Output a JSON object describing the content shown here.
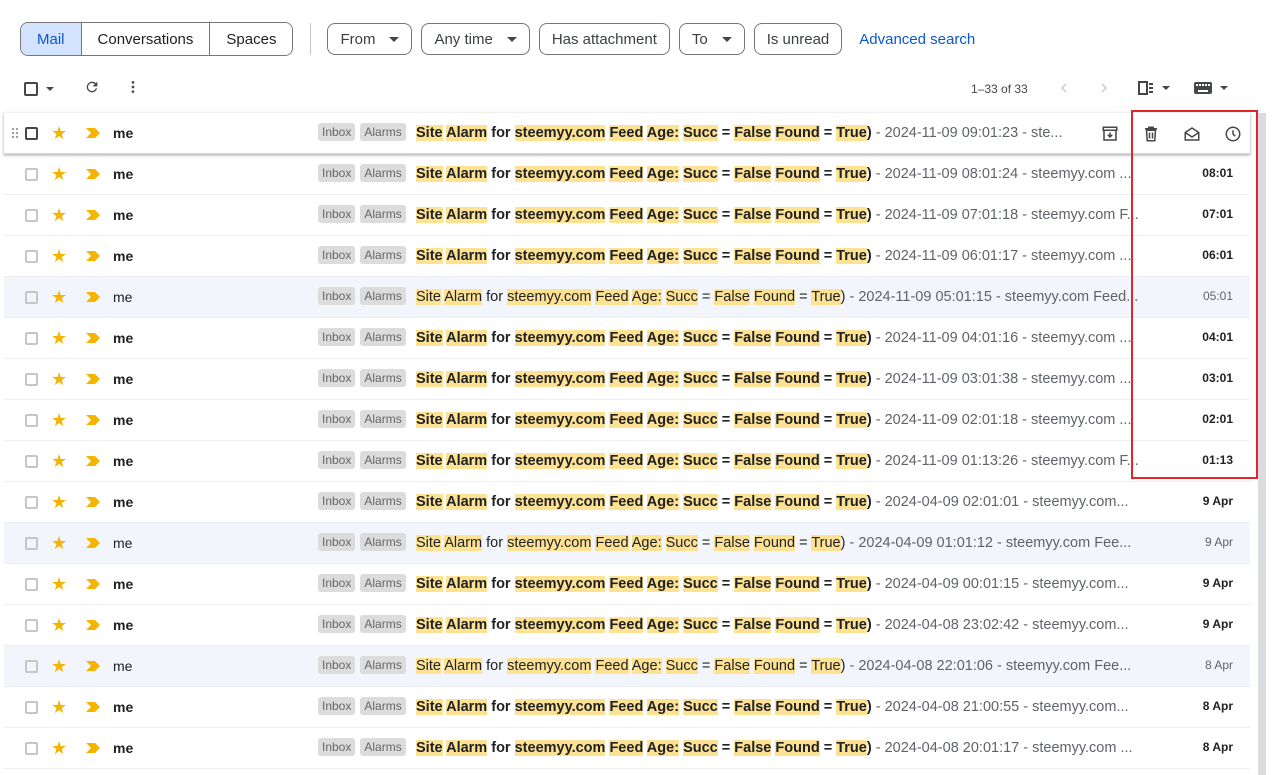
{
  "tabs": [
    {
      "label": "Mail",
      "active": true
    },
    {
      "label": "Conversations",
      "active": false
    },
    {
      "label": "Spaces",
      "active": false
    }
  ],
  "filters": {
    "from": "From",
    "any_time": "Any time",
    "has_attachment": "Has attachment",
    "to": "To",
    "is_unread": "Is unread",
    "advanced_search": "Advanced search"
  },
  "toolbar": {
    "pager": "1–33 of 33",
    "icons": [
      "select-all-checkbox",
      "refresh-icon",
      "more-vert-icon",
      "prev-page-icon",
      "next-page-icon",
      "split-pane-icon",
      "keyboard-icon"
    ]
  },
  "hover_actions": [
    "archive-icon",
    "delete-icon",
    "mark-read-icon",
    "snooze-icon"
  ],
  "colors": {
    "accent": "#0b57d0",
    "chip_active_bg": "#d3e3fd",
    "highlight": "#fde293",
    "star": "#f4b400",
    "annotation_box": "#e3242b"
  },
  "emails": [
    {
      "sender": "me",
      "labels": [
        "Inbox",
        "Alarms"
      ],
      "subject_parts": [
        "Site",
        "Alarm",
        "for",
        "steemyy.com",
        "Feed",
        "Age:",
        "Succ",
        "=",
        "False",
        "Found",
        "=",
        "True)"
      ],
      "snippet": "- 2024-11-09 09:01:23 - ste...",
      "date": "",
      "unread": true,
      "hover": true
    },
    {
      "sender": "me",
      "labels": [
        "Inbox",
        "Alarms"
      ],
      "snippet": "- 2024-11-09 08:01:24 - steemyy.com ...",
      "date": "08:01",
      "unread": true
    },
    {
      "sender": "me",
      "labels": [
        "Inbox",
        "Alarms"
      ],
      "snippet": "- 2024-11-09 07:01:18 - steemyy.com F...",
      "date": "07:01",
      "unread": true
    },
    {
      "sender": "me",
      "labels": [
        "Inbox",
        "Alarms"
      ],
      "snippet": "- 2024-11-09 06:01:17 - steemyy.com ...",
      "date": "06:01",
      "unread": true
    },
    {
      "sender": "me",
      "labels": [
        "Inbox",
        "Alarms"
      ],
      "snippet": "- 2024-11-09 05:01:15 - steemyy.com Feed...",
      "date": "05:01",
      "unread": false
    },
    {
      "sender": "me",
      "labels": [
        "Inbox",
        "Alarms"
      ],
      "snippet": "- 2024-11-09 04:01:16 - steemyy.com ...",
      "date": "04:01",
      "unread": true
    },
    {
      "sender": "me",
      "labels": [
        "Inbox",
        "Alarms"
      ],
      "snippet": "- 2024-11-09 03:01:38 - steemyy.com ...",
      "date": "03:01",
      "unread": true
    },
    {
      "sender": "me",
      "labels": [
        "Inbox",
        "Alarms"
      ],
      "snippet": "- 2024-11-09 02:01:18 - steemyy.com ...",
      "date": "02:01",
      "unread": true
    },
    {
      "sender": "me",
      "labels": [
        "Inbox",
        "Alarms"
      ],
      "snippet": "- 2024-11-09 01:13:26 - steemyy.com F...",
      "date": "01:13",
      "unread": true
    },
    {
      "sender": "me",
      "labels": [
        "Inbox",
        "Alarms"
      ],
      "snippet": "- 2024-04-09 02:01:01 - steemyy.com...",
      "date": "9 Apr",
      "unread": true
    },
    {
      "sender": "me",
      "labels": [
        "Inbox",
        "Alarms"
      ],
      "snippet": "- 2024-04-09 01:01:12 - steemyy.com Fee...",
      "date": "9 Apr",
      "unread": false
    },
    {
      "sender": "me",
      "labels": [
        "Inbox",
        "Alarms"
      ],
      "snippet": "- 2024-04-09 00:01:15 - steemyy.com...",
      "date": "9 Apr",
      "unread": true
    },
    {
      "sender": "me",
      "labels": [
        "Inbox",
        "Alarms"
      ],
      "snippet": "- 2024-04-08 23:02:42 - steemyy.com...",
      "date": "9 Apr",
      "unread": true
    },
    {
      "sender": "me",
      "labels": [
        "Inbox",
        "Alarms"
      ],
      "snippet": "- 2024-04-08 22:01:06 - steemyy.com Fee...",
      "date": "8 Apr",
      "unread": false
    },
    {
      "sender": "me",
      "labels": [
        "Inbox",
        "Alarms"
      ],
      "snippet": "- 2024-04-08 21:00:55 - steemyy.com...",
      "date": "8 Apr",
      "unread": true
    },
    {
      "sender": "me",
      "labels": [
        "Inbox",
        "Alarms"
      ],
      "snippet": "- 2024-04-08 20:01:17 - steemyy.com ...",
      "date": "8 Apr",
      "unread": true
    }
  ]
}
